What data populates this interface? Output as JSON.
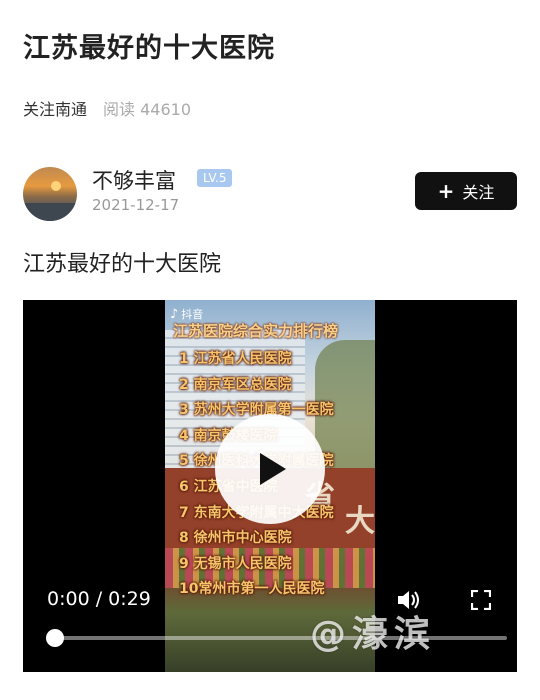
{
  "article": {
    "title": "江苏最好的十大医院",
    "source": "关注南通",
    "reads": "阅读 44610",
    "body": "江苏最好的十大医院"
  },
  "author": {
    "name": "不够丰富",
    "level": "LV.5",
    "date": "2021-12-17",
    "follow_label": "关注"
  },
  "video": {
    "overlay_app": "抖音",
    "list_title": "江苏医院综合实力排行榜",
    "wall_chars": [
      "省",
      "大"
    ],
    "ranking": [
      "1 江苏省人民医院",
      "2 南京军区总医院",
      "3 苏州大学附属第一医院",
      "4 南京鼓楼医院",
      "5 徐州医科大学附属医院",
      "6 江苏省中医院",
      "7 东南大学附属中大医院",
      "8 徐州市中心医院",
      "9 无锡市人民医院",
      "10常州市第一人民医院"
    ],
    "time_display": "0:00 / 0:29",
    "progress": 0
  },
  "watermark": "@濠滨",
  "colors": {
    "follow_button": "#111111",
    "level_badge": "#a9c8f0"
  }
}
